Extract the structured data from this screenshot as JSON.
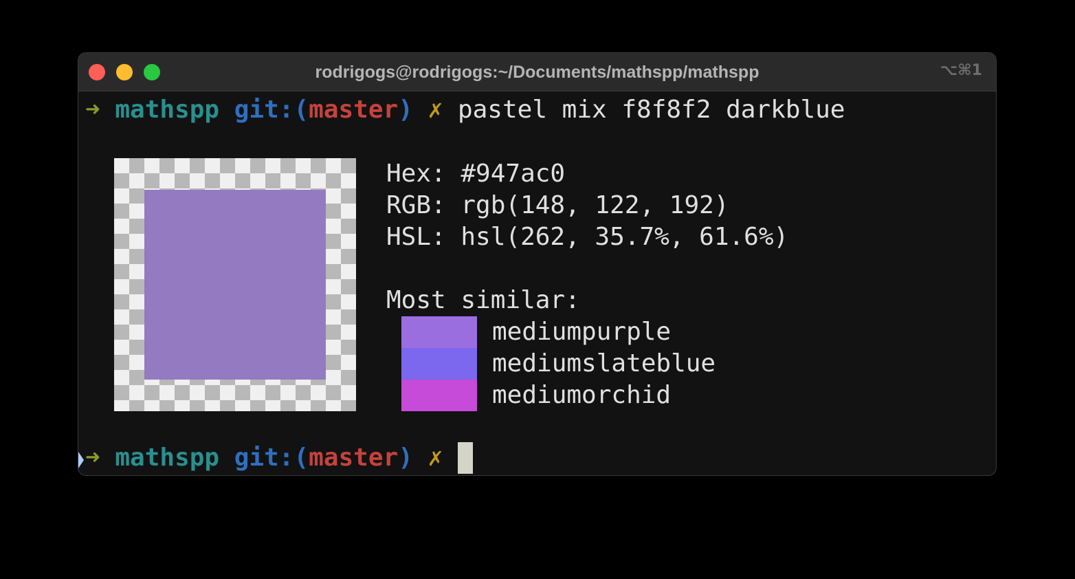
{
  "window": {
    "title": "rodrigogs@rodrigogs:~/Documents/mathspp/mathspp",
    "shortcut": "⌥⌘1",
    "traffic_lights": {
      "close_color": "#ff5f57",
      "minimize_color": "#febc2e",
      "zoom_color": "#28c840"
    }
  },
  "prompt": {
    "arrow": "➜",
    "directory": "mathspp",
    "git_prefix": "git:(",
    "branch": "master",
    "git_suffix": ")",
    "dirty_mark": "✗"
  },
  "command": "pastel mix f8f8f2 darkblue",
  "result": {
    "color_hex": "#947ac0",
    "hex_line": "Hex: #947ac0",
    "rgb_line": "RGB: rgb(148, 122, 192)",
    "hsl_line": "HSL: hsl(262, 35.7%, 61.6%)",
    "similar_heading": "Most similar:",
    "similar": [
      {
        "name": "mediumpurple",
        "color": "#9b6ee0"
      },
      {
        "name": "mediumslateblue",
        "color": "#7b68ee"
      },
      {
        "name": "mediumorchid",
        "color": "#c64bd8"
      }
    ]
  }
}
